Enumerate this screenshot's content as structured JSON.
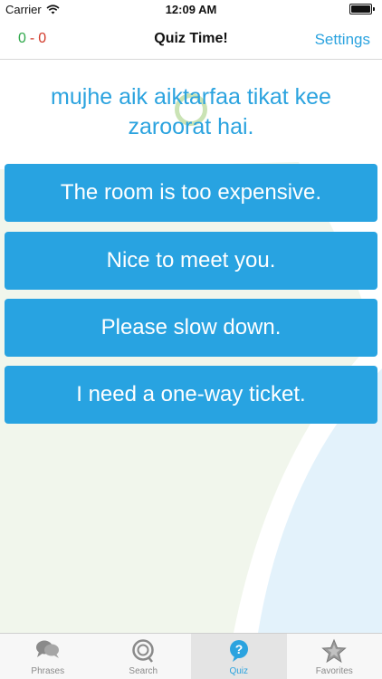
{
  "status_bar": {
    "carrier": "Carrier",
    "time": "12:09 AM"
  },
  "nav": {
    "title": "Quiz Time!",
    "settings_label": "Settings"
  },
  "score": {
    "correct": "0",
    "separator": "-",
    "wrong": "0"
  },
  "quiz": {
    "question": "mujhe aik aiktarfaa tikat kee zaroorat hai.",
    "answers": [
      "The room is too expensive.",
      "Nice to meet you.",
      "Please slow down.",
      "I need a one-way ticket."
    ]
  },
  "tabs": [
    {
      "label": "Phrases",
      "icon": "speech-bubbles-icon"
    },
    {
      "label": "Search",
      "icon": "search-icon"
    },
    {
      "label": "Quiz",
      "icon": "quiz-icon",
      "active": true
    },
    {
      "label": "Favorites",
      "icon": "star-icon"
    }
  ],
  "colors": {
    "accent": "#2ba3df",
    "button": "#28a3e1",
    "score_correct": "#2ea84a",
    "score_wrong": "#d23a2a",
    "bg_green": "#f1f6ec",
    "bg_blue": "#e3f2fb"
  }
}
